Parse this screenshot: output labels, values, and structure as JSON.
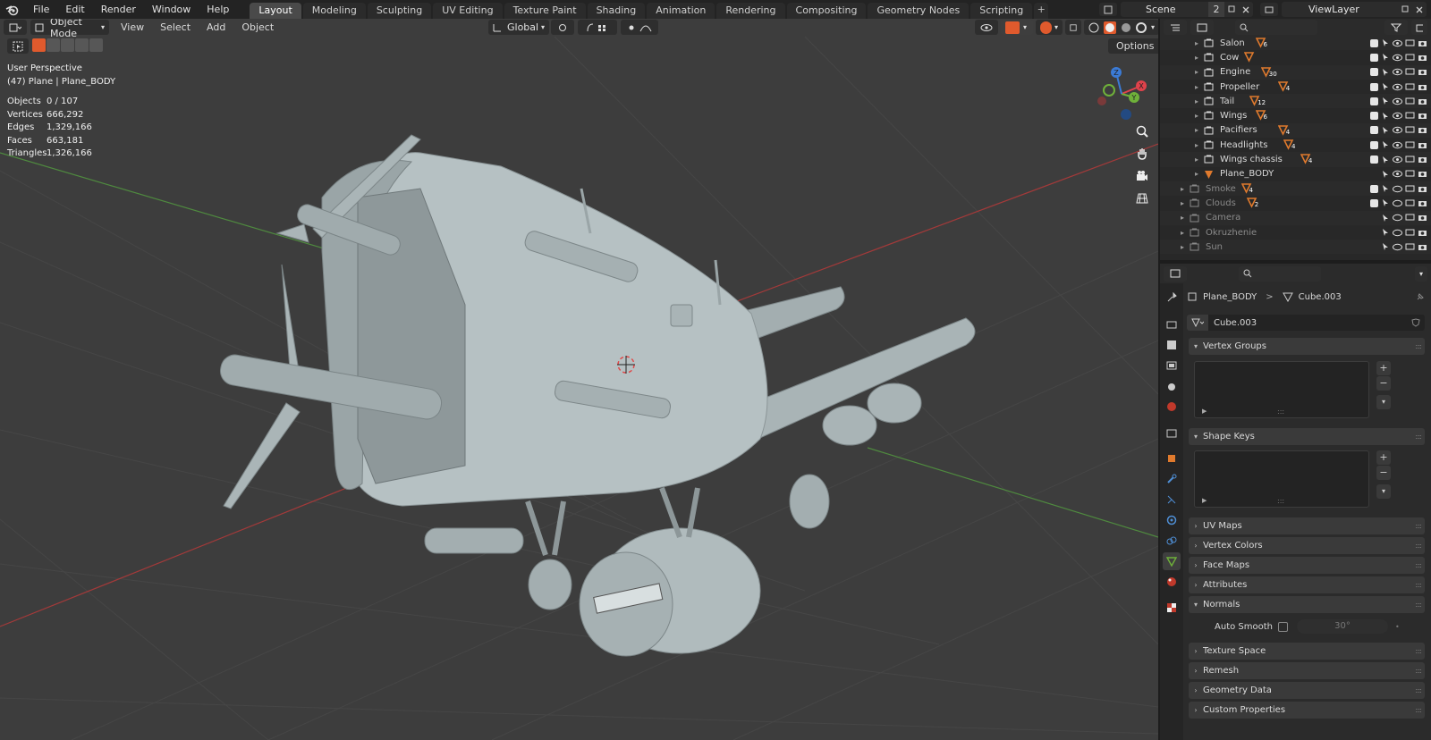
{
  "topbar": {
    "menus": [
      "File",
      "Edit",
      "Render",
      "Window",
      "Help"
    ],
    "workspaces": [
      "Layout",
      "Modeling",
      "Sculpting",
      "UV Editing",
      "Texture Paint",
      "Shading",
      "Animation",
      "Rendering",
      "Compositing",
      "Geometry Nodes",
      "Scripting"
    ],
    "active_workspace": "Layout",
    "add_tab": "+",
    "scene_name": "Scene",
    "scene_users": "2",
    "view_layer": "ViewLayer"
  },
  "viewport": {
    "mode": "Object Mode",
    "menus": [
      "View",
      "Select",
      "Add",
      "Object"
    ],
    "transform_orientation": "Global",
    "options_label": "Options",
    "view_name": "User Perspective",
    "active_object": "(47) Plane | Plane_BODY",
    "stats": [
      {
        "label": "Objects",
        "value": "0 / 107"
      },
      {
        "label": "Vertices",
        "value": "666,292"
      },
      {
        "label": "Edges",
        "value": "1,329,166"
      },
      {
        "label": "Faces",
        "value": "663,181"
      },
      {
        "label": "Triangles",
        "value": "1,326,166"
      }
    ],
    "gizmo_axes": {
      "x": "X",
      "y": "Y",
      "z": "Z"
    },
    "colors": {
      "x_axis": "#e0424b",
      "y_axis": "#6fb13a",
      "z_axis": "#3b7bd6",
      "background": "#3d3d3d"
    }
  },
  "outliner": {
    "search_placeholder": "",
    "items": [
      {
        "name": "Salon",
        "badge": "6",
        "dim": false
      },
      {
        "name": "Cow",
        "badge": "",
        "dim": false
      },
      {
        "name": "Engine",
        "badge": "30",
        "dim": false
      },
      {
        "name": "Propeller",
        "badge": "4",
        "dim": false
      },
      {
        "name": "Tail",
        "badge": "12",
        "dim": false
      },
      {
        "name": "Wings",
        "badge": "6",
        "dim": false
      },
      {
        "name": "Pacifiers",
        "badge": "4",
        "dim": false
      },
      {
        "name": "Headlights",
        "badge": "4",
        "dim": false
      },
      {
        "name": "Wings chassis",
        "badge": "4",
        "dim": false
      },
      {
        "name": "Plane_BODY",
        "badge": "",
        "dim": false
      },
      {
        "name": "Smoke",
        "badge": "4",
        "dim": true
      },
      {
        "name": "Clouds",
        "badge": "2",
        "dim": true
      },
      {
        "name": "Camera",
        "badge": "",
        "dim": true
      },
      {
        "name": "Okruzhenie",
        "badge": "",
        "dim": true
      },
      {
        "name": "Sun",
        "badge": "",
        "dim": true
      }
    ]
  },
  "properties": {
    "breadcrumb_object": "Plane_BODY",
    "breadcrumb_sep": ">",
    "breadcrumb_data": "Cube.003",
    "mesh_name": "Cube.003",
    "panels": {
      "vertex_groups": "Vertex Groups",
      "shape_keys": "Shape Keys",
      "uv_maps": "UV Maps",
      "vertex_colors": "Vertex Colors",
      "face_maps": "Face Maps",
      "attributes": "Attributes",
      "normals": "Normals",
      "texture_space": "Texture Space",
      "remesh": "Remesh",
      "geometry_data": "Geometry Data",
      "custom_properties": "Custom Properties"
    },
    "auto_smooth_label": "Auto Smooth",
    "auto_smooth_angle": "30°"
  }
}
